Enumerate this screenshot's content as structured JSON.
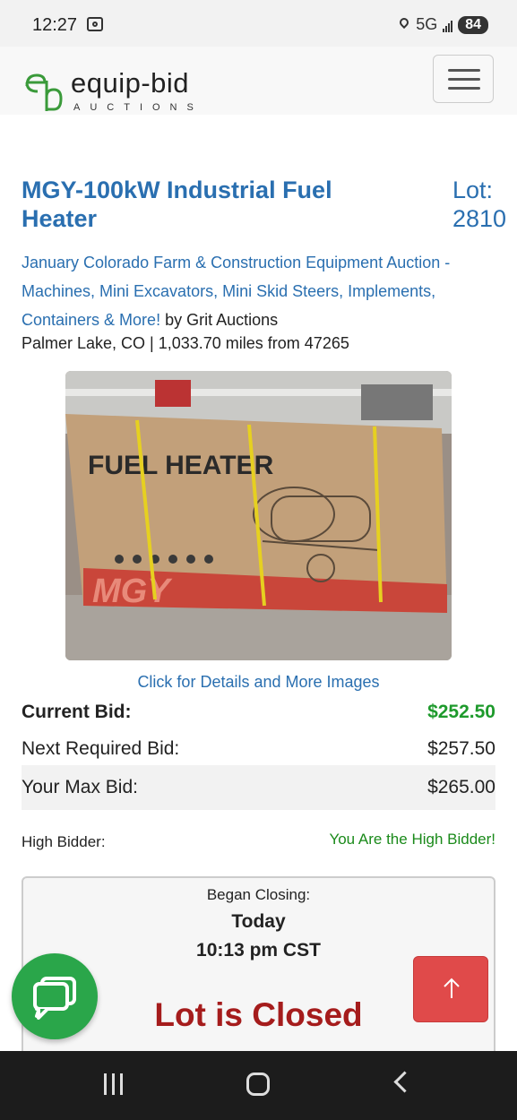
{
  "status_bar": {
    "time": "12:27",
    "network": "5G",
    "battery": "84"
  },
  "header": {
    "logo_text": "equip-bid",
    "logo_subtext": "AUCTIONS",
    "menu_icon": "hamburger-icon"
  },
  "lot": {
    "title": "MGY-100kW Industrial Fuel Heater",
    "lot_label": "Lot: 2810",
    "auction_link": "January Colorado Farm & Construction Equipment Auction - Machines, Mini Excavators, Mini Skid Steers, Implements, Containers & More!",
    "auction_by": " by Grit Auctions",
    "location": "Palmer Lake, CO | 1,033.70 miles from 47265",
    "image_box_text": "FUEL HEATER",
    "image_brand_text": "MGY",
    "details_link": "Click for Details and More Images"
  },
  "bids": {
    "current_label": "Current Bid:",
    "current_value": "$252.50",
    "next_label": "Next Required Bid:",
    "next_value": "$257.50",
    "max_label": "Your Max Bid:",
    "max_value": "$265.00",
    "high_bidder_label": "High Bidder:",
    "high_bidder_value": "You Are the High Bidder!"
  },
  "closing": {
    "began_label": "Began Closing:",
    "day": "Today",
    "time": "10:13 pm CST",
    "status": "Lot is Closed"
  },
  "colors": {
    "link": "#2a6fb0",
    "green": "#1e9a2c",
    "closed_red": "#a51c1c",
    "chat_green": "#2aa64a",
    "top_red": "#e04a4a"
  }
}
